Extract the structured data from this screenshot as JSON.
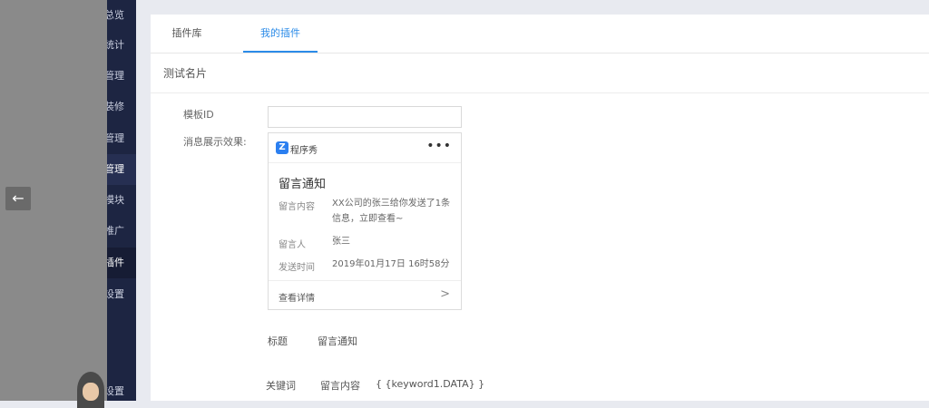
{
  "sidebar": {
    "items": [
      {
        "label": "总览"
      },
      {
        "label": "统计"
      },
      {
        "label": "管理"
      },
      {
        "label": "装修"
      },
      {
        "label": "管理"
      },
      {
        "label": "管理"
      },
      {
        "label": "模块"
      },
      {
        "label": "推广"
      },
      {
        "label": "插件"
      },
      {
        "label": "设置"
      },
      {
        "label": "设置"
      }
    ]
  },
  "drawer": {
    "back_icon": "arrow-left-icon",
    "back_glyph": "←"
  },
  "tabs": [
    {
      "label": "插件库"
    },
    {
      "label": "我的插件"
    }
  ],
  "section": {
    "title": "测试名片"
  },
  "form": {
    "template_label": "模板ID",
    "template_value": "",
    "preview_label": "消息展示效果:"
  },
  "card": {
    "brand_logo": "Z",
    "brand_name": "程序秀",
    "more_glyph": "•••",
    "title": "留言通知",
    "rows": [
      {
        "label": "留言内容",
        "value": "XX公司的张三给你发送了1条信息，立即查看~"
      },
      {
        "label": "留言人",
        "value": "张三"
      },
      {
        "label": "发送时间",
        "value": "2019年01月17日 16时58分"
      }
    ],
    "footer_link": "查看详情",
    "chevron_glyph": ">"
  },
  "meta": {
    "title_label": "标题",
    "title_value": "留言通知",
    "keyword_label": "关键词",
    "keyword_name": "留言内容",
    "keyword_value": "{ {keyword1.DATA} }"
  },
  "colors": {
    "accent": "#2b8be8",
    "sidebar_bg": "#1d2542"
  }
}
